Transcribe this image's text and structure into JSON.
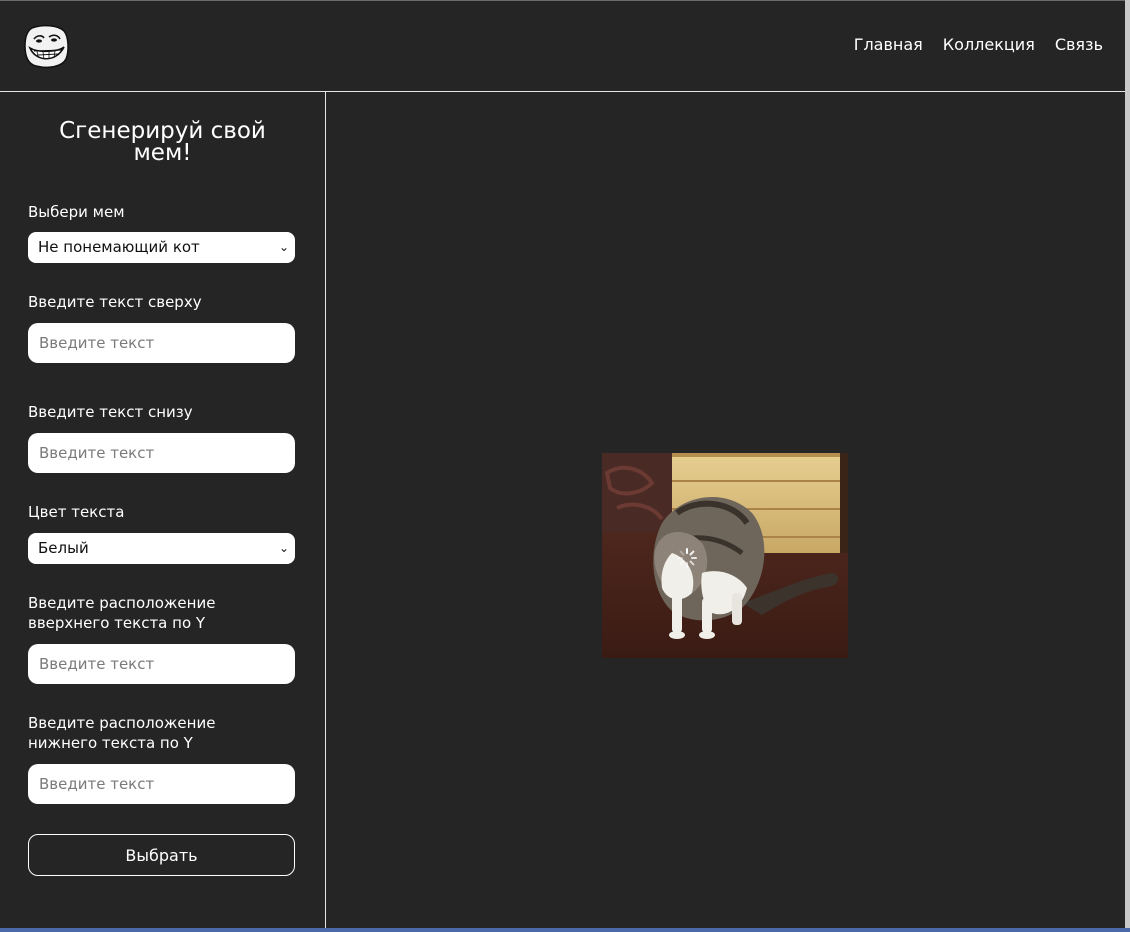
{
  "header": {
    "logo_icon": "troll-face-logo-icon",
    "nav": [
      {
        "label": "Главная"
      },
      {
        "label": "Коллекция"
      },
      {
        "label": "Связь"
      }
    ]
  },
  "form": {
    "title": "Сгенерируй свой мем!",
    "meme_select": {
      "label": "Выбери мем",
      "selected": "Не понемающий кот"
    },
    "top_text": {
      "label": "Введите текст сверху",
      "placeholder": "Введите текст"
    },
    "bottom_text": {
      "label": "Введите текст снизу",
      "placeholder": "Введите текст"
    },
    "color_select": {
      "label": "Цвет текста",
      "selected": "Белый"
    },
    "top_y": {
      "label": "Введите расположение вверхнего текста по Y",
      "placeholder": "Введите текст"
    },
    "bottom_y": {
      "label": "Введите расположение нижнего текста по Y",
      "placeholder": "Введите текст"
    },
    "submit_label": "Выбрать"
  },
  "preview": {
    "image": "confused-loading-cat-image",
    "overlay_icon": "loading-spinner-icon"
  },
  "colors": {
    "background": "#252525",
    "divider": "#e6e6e6",
    "text": "#ffffff",
    "input_bg": "#ffffff"
  }
}
